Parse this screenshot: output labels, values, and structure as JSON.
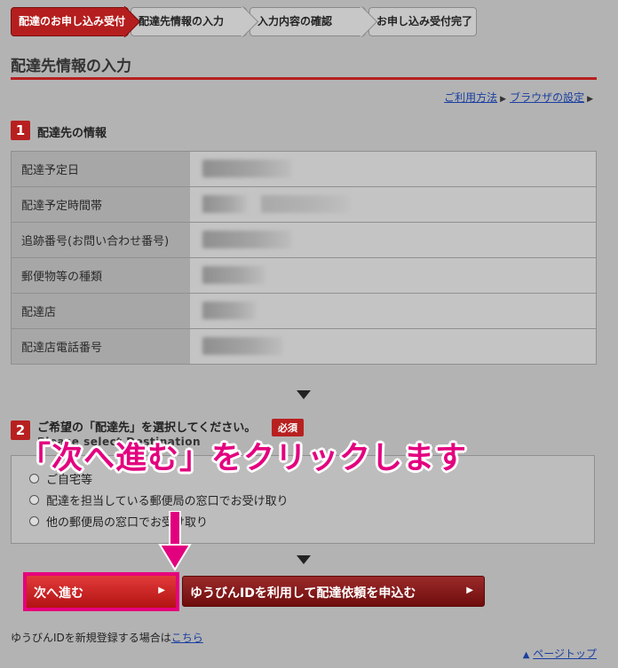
{
  "steps": [
    {
      "label": "配達のお申し込み受付",
      "active": true
    },
    {
      "label": "配達先情報の入力",
      "active": false
    },
    {
      "label": "入力内容の確認",
      "active": false
    },
    {
      "label": "お申し込み受付完了",
      "active": false
    }
  ],
  "page_title": "配達先情報の入力",
  "toplinks": {
    "usage": "ご利用方法",
    "browser": "ブラウザの設定"
  },
  "section1": {
    "number": "1",
    "title": "配達先の情報",
    "rows": [
      {
        "label": "配達予定日"
      },
      {
        "label": "配達予定時間帯"
      },
      {
        "label": "追跡番号(お問い合わせ番号)"
      },
      {
        "label": "郵便物等の種類"
      },
      {
        "label": "配達店"
      },
      {
        "label": "配達店電話番号"
      }
    ]
  },
  "section2": {
    "number": "2",
    "title": "ご希望の「配達先」を選択してください。",
    "required_label": "必須",
    "subtitle_en": "Please select Destination",
    "options": [
      {
        "label": "ご自宅等"
      },
      {
        "label": "配達を担当している郵便局の窓口でお受け取り"
      },
      {
        "label": "他の郵便局の窓口でお受け取り"
      }
    ]
  },
  "overlay": "「次へ進む」をクリックします",
  "buttons": {
    "next": "次へ進む",
    "yupin": "ゆうびんIDを利用して配達依頼を申込む"
  },
  "footer": {
    "note": "ゆうびんIDを新規登録する場合は",
    "link": "こちら",
    "pagetop": "ページトップ"
  },
  "colors": {
    "accent": "#b82020",
    "highlight": "#e3007f",
    "link": "#1a3fa0"
  }
}
